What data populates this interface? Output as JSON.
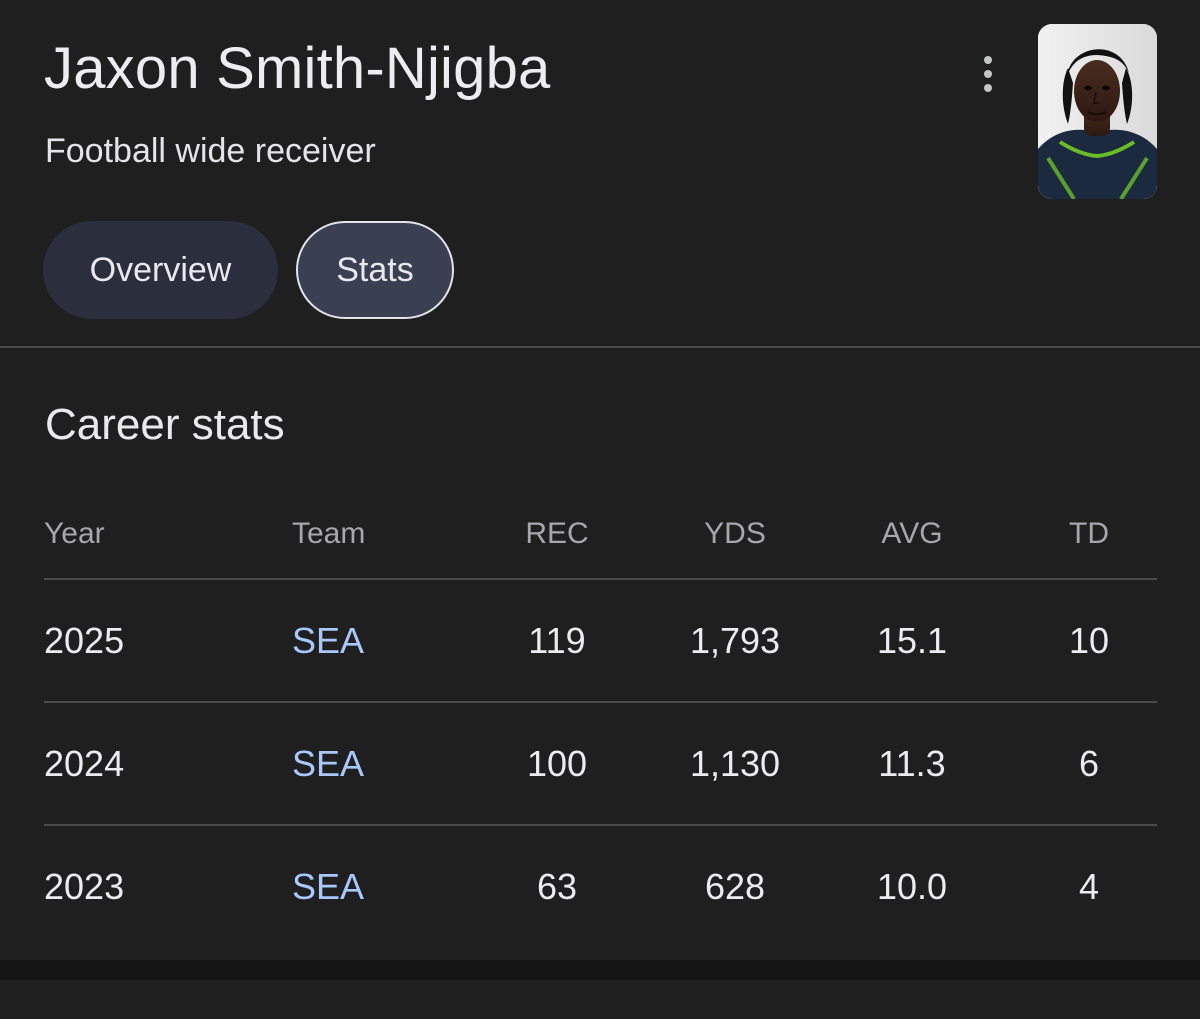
{
  "header": {
    "name": "Jaxon Smith-Njigba",
    "subtitle": "Football wide receiver",
    "avatar_icon": "player-photo",
    "more_icon": "more-vert-icon"
  },
  "tabs": [
    {
      "label": "Overview",
      "selected": false
    },
    {
      "label": "Stats",
      "selected": true
    }
  ],
  "career_stats": {
    "title": "Career stats",
    "columns": [
      "Year",
      "Team",
      "REC",
      "YDS",
      "AVG",
      "TD"
    ],
    "rows": [
      [
        "2025",
        "SEA",
        "119",
        "1,793",
        "15.1",
        "10"
      ],
      [
        "2024",
        "SEA",
        "100",
        "1,130",
        "11.3",
        "6"
      ],
      [
        "2023",
        "SEA",
        "63",
        "628",
        "10.0",
        "4"
      ]
    ]
  },
  "colors": {
    "background": "#1f1f1f",
    "link": "#a8c7fa",
    "tab_selected_bg": "#3a3f52",
    "tab_bg": "#2b2f3d"
  }
}
